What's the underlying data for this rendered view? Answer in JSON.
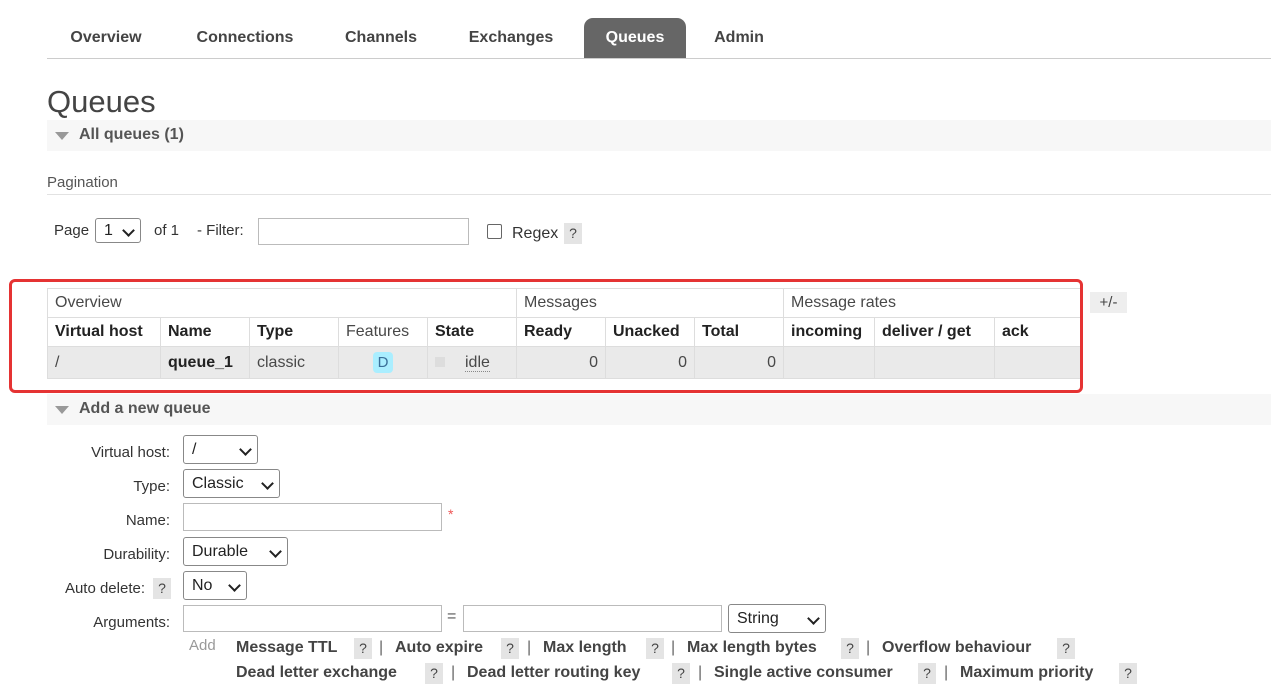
{
  "nav": {
    "tabs": [
      {
        "label": "Overview"
      },
      {
        "label": "Connections"
      },
      {
        "label": "Channels"
      },
      {
        "label": "Exchanges"
      },
      {
        "label": "Queues"
      },
      {
        "label": "Admin"
      }
    ],
    "active": "Queues"
  },
  "page": {
    "title": "Queues"
  },
  "all_queues": {
    "heading": "All queues (1)"
  },
  "pagination": {
    "label": "Pagination",
    "page_label": "Page",
    "page_value": "1",
    "of_label": "of 1",
    "filter_label": "- Filter:",
    "filter_value": "",
    "regex_label": "Regex",
    "regex_checked": false,
    "help": "?"
  },
  "table": {
    "groups": [
      "Overview",
      "Messages",
      "Message rates"
    ],
    "columns": [
      "Virtual host",
      "Name",
      "Type",
      "Features",
      "State",
      "Ready",
      "Unacked",
      "Total",
      "incoming",
      "deliver / get",
      "ack"
    ],
    "toggle": "+/-",
    "rows": [
      {
        "vhost": "/",
        "name": "queue_1",
        "type": "classic",
        "feature": "D",
        "state": "idle",
        "ready": "0",
        "unacked": "0",
        "total": "0",
        "incoming": "",
        "deliver_get": "",
        "ack": ""
      }
    ]
  },
  "add_queue": {
    "heading": "Add a new queue",
    "vhost_label": "Virtual host:",
    "vhost_value": "/",
    "type_label": "Type:",
    "type_value": "Classic",
    "name_label": "Name:",
    "name_value": "",
    "required": "*",
    "durability_label": "Durability:",
    "durability_value": "Durable",
    "autodelete_label": "Auto delete:",
    "autodelete_value": "No",
    "help": "?",
    "arguments_label": "Arguments:",
    "arg_key": "",
    "arg_value": "",
    "equals": "=",
    "arg_type": "String",
    "add_label": "Add",
    "links_row1": [
      "Message TTL",
      "Auto expire",
      "Max length",
      "Max length bytes",
      "Overflow behaviour"
    ],
    "links_row2": [
      "Dead letter exchange",
      "Dead letter routing key",
      "Single active consumer",
      "Maximum priority"
    ],
    "separator": "|"
  }
}
